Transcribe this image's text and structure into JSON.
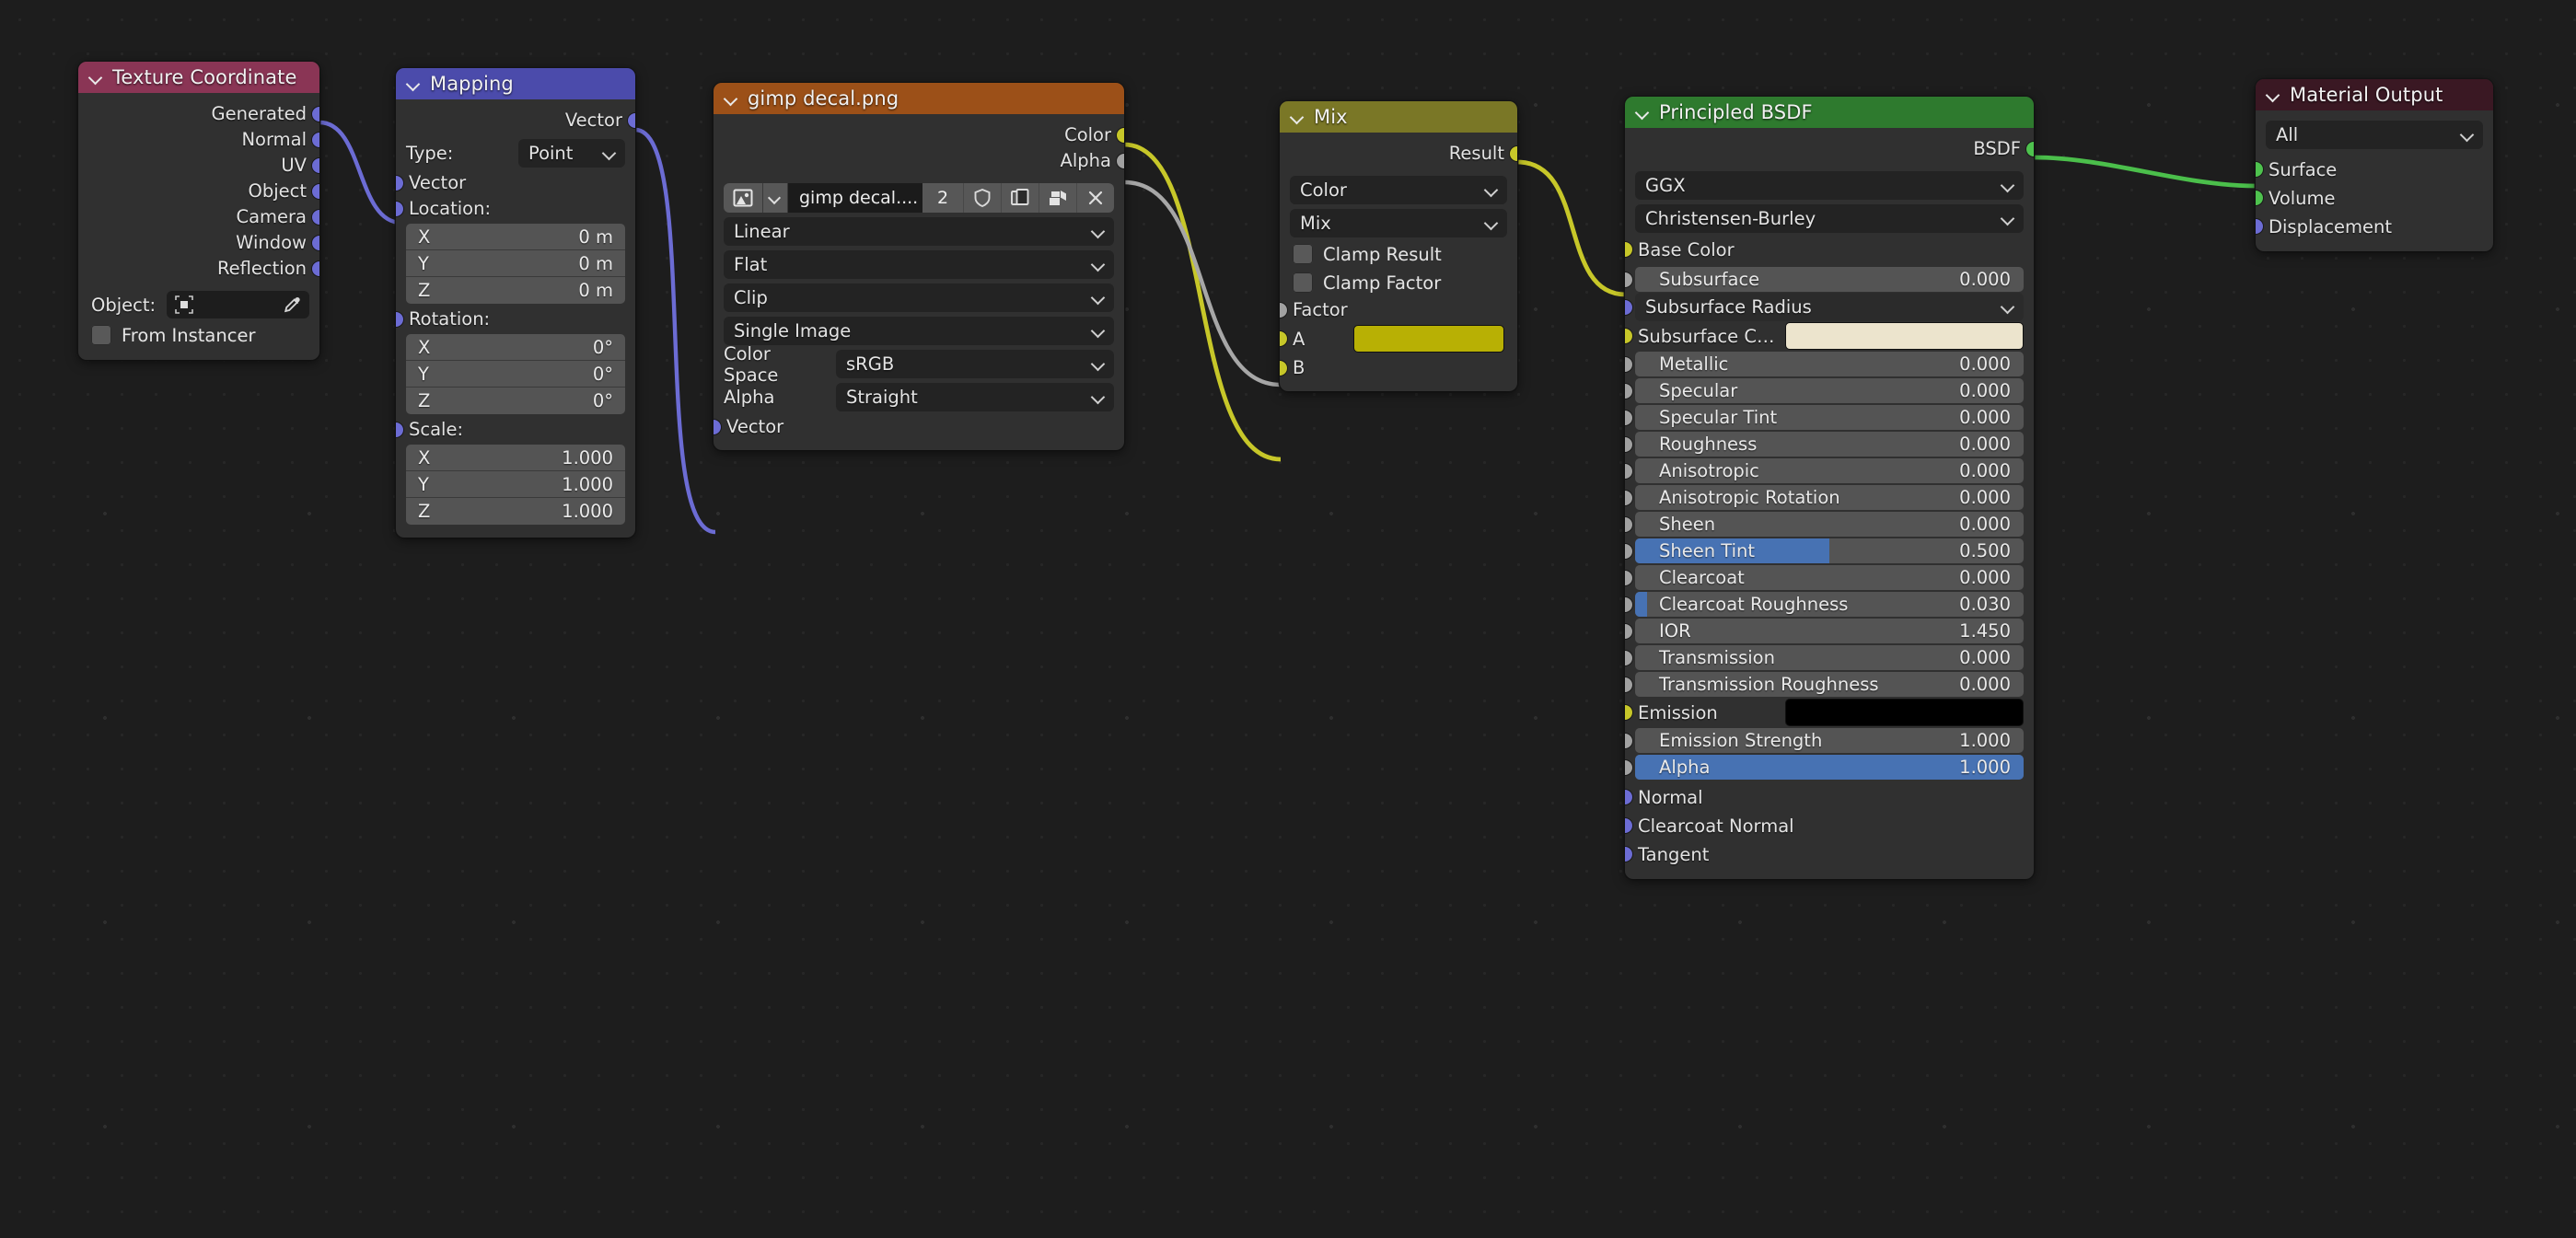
{
  "app": {
    "editor": "Blender Shader Node Editor",
    "background": "#1d1d1d"
  },
  "colors": {
    "header_input": "#8a3555",
    "header_vector": "#4b4bab",
    "header_texture": "#9c5018",
    "header_converter": "#7a7726",
    "header_shader": "#2e7a2e",
    "header_output": "#3a1823",
    "socket_vector": "#6c6cd4",
    "socket_color": "#c7c729",
    "socket_value": "#a1a1a1",
    "socket_shader": "#4ec24e",
    "slider_fill": "#4772b3",
    "mix_a_color": "#b8b004",
    "subsurface_color": "#ece4cd",
    "emission_color": "#000000"
  },
  "nodes": {
    "texture_coordinate": {
      "title": "Texture Coordinate",
      "outputs": [
        "Generated",
        "Normal",
        "UV",
        "Object",
        "Camera",
        "Window",
        "Reflection"
      ],
      "object_label": "Object:",
      "object_value": "",
      "object_icon": "object-placeholder-icon",
      "eyedropper_icon": "eyedropper-icon",
      "from_instancer_label": "From Instancer",
      "from_instancer_checked": false
    },
    "mapping": {
      "title": "Mapping",
      "output": "Vector",
      "type_label": "Type:",
      "type_value": "Point",
      "vector_input": "Vector",
      "location_label": "Location:",
      "location": [
        {
          "axis": "X",
          "value": "0 m"
        },
        {
          "axis": "Y",
          "value": "0 m"
        },
        {
          "axis": "Z",
          "value": "0 m"
        }
      ],
      "rotation_label": "Rotation:",
      "rotation": [
        {
          "axis": "X",
          "value": "0°"
        },
        {
          "axis": "Y",
          "value": "0°"
        },
        {
          "axis": "Z",
          "value": "0°"
        }
      ],
      "scale_label": "Scale:",
      "scale": [
        {
          "axis": "X",
          "value": "1.000"
        },
        {
          "axis": "Y",
          "value": "1.000"
        },
        {
          "axis": "Z",
          "value": "1.000"
        }
      ]
    },
    "image_texture": {
      "title": "gimp decal.png",
      "outputs": [
        "Color",
        "Alpha"
      ],
      "datablock": {
        "browse_icon": "image-datablock-icon",
        "name": "gimp decal....",
        "users": "2",
        "shield_icon": "fake-user-shield-icon",
        "copy_icon": "new-copy-icon",
        "pack_icon": "pack-image-icon",
        "close_icon": "unlink-x-icon"
      },
      "interpolation": "Linear",
      "projection": "Flat",
      "extension": "Clip",
      "source": "Single Image",
      "color_space_label": "Color Space",
      "color_space_value": "sRGB",
      "alpha_label": "Alpha",
      "alpha_value": "Straight",
      "vector_input": "Vector"
    },
    "mix": {
      "title": "Mix",
      "output": "Result",
      "data_type": "Color",
      "blend_mode": "Mix",
      "clamp_result_label": "Clamp Result",
      "clamp_result_checked": false,
      "clamp_factor_label": "Clamp Factor",
      "clamp_factor_checked": false,
      "factor_label": "Factor",
      "a_label": "A",
      "a_color": "#b8b004",
      "b_label": "B"
    },
    "principled_bsdf": {
      "title": "Principled BSDF",
      "output": "BSDF",
      "distribution": "GGX",
      "subsurface_method": "Christensen-Burley",
      "base_color_label": "Base Color",
      "subsurface_radius_label": "Subsurface Radius",
      "subsurface_color_label": "Subsurface C…",
      "subsurface_color_value": "#ece4cd",
      "emission_label": "Emission",
      "emission_color_value": "#000000",
      "properties": [
        {
          "label": "Subsurface",
          "value": "0.000",
          "fill": 0
        },
        {
          "label": "Metallic",
          "value": "0.000",
          "fill": 0
        },
        {
          "label": "Specular",
          "value": "0.000",
          "fill": 0
        },
        {
          "label": "Specular Tint",
          "value": "0.000",
          "fill": 0
        },
        {
          "label": "Roughness",
          "value": "0.000",
          "fill": 0
        },
        {
          "label": "Anisotropic",
          "value": "0.000",
          "fill": 0
        },
        {
          "label": "Anisotropic Rotation",
          "value": "0.000",
          "fill": 0
        },
        {
          "label": "Sheen",
          "value": "0.000",
          "fill": 0
        },
        {
          "label": "Sheen Tint",
          "value": "0.500",
          "fill": 50
        },
        {
          "label": "Clearcoat",
          "value": "0.000",
          "fill": 0
        },
        {
          "label": "Clearcoat Roughness",
          "value": "0.030",
          "fill": 3
        },
        {
          "label": "IOR",
          "value": "1.450",
          "fill": 0
        },
        {
          "label": "Transmission",
          "value": "0.000",
          "fill": 0
        },
        {
          "label": "Transmission Roughness",
          "value": "0.000",
          "fill": 0
        },
        {
          "label": "Emission Strength",
          "value": "1.000",
          "fill": 0
        },
        {
          "label": "Alpha",
          "value": "1.000",
          "fill": 100
        }
      ],
      "vector_inputs": [
        "Normal",
        "Clearcoat Normal",
        "Tangent"
      ]
    },
    "material_output": {
      "title": "Material Output",
      "target": "All",
      "inputs": [
        "Surface",
        "Volume",
        "Displacement"
      ]
    }
  },
  "links": [
    {
      "from": "texture_coordinate.Generated",
      "to": "mapping.Vector",
      "color": "#6c6cd4"
    },
    {
      "from": "mapping.Vector",
      "to": "image_texture.Vector",
      "color": "#6c6cd4"
    },
    {
      "from": "image_texture.Color",
      "to": "mix.B",
      "color": "#c7c729"
    },
    {
      "from": "image_texture.Alpha",
      "to": "mix.Factor",
      "color": "#a1a1a1"
    },
    {
      "from": "mix.Result",
      "to": "principled_bsdf.Base Color",
      "color": "#c7c729"
    },
    {
      "from": "principled_bsdf.BSDF",
      "to": "material_output.Surface",
      "color": "#4ec24e"
    }
  ]
}
